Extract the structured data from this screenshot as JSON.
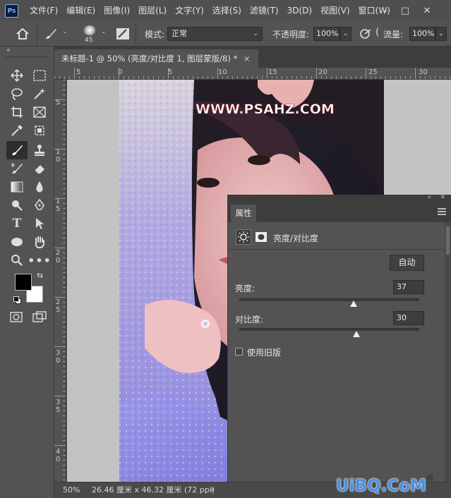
{
  "app": {
    "logo": "Ps"
  },
  "menu": [
    "文件(F)",
    "编辑(E)",
    "图像(I)",
    "图层(L)",
    "文字(Y)",
    "选择(S)",
    "滤镜(T)",
    "3D(D)",
    "视图(V)",
    "窗口(W)"
  ],
  "window_controls": {
    "minimize": "–",
    "maximize": "□",
    "close": "✕"
  },
  "options": {
    "brush_size": "45",
    "mode_label": "模式:",
    "mode_value": "正常",
    "opacity_label": "不透明度:",
    "opacity_value": "100%",
    "flow_label": "流量:",
    "flow_value": "100%"
  },
  "document": {
    "tab_title": "未标题-1 @ 50% (亮度/对比度 1, 图层蒙版/8) *",
    "tab_close": "×",
    "watermark_text": "WWW.PSAHZ.COM"
  },
  "rulers": {
    "h_labels": [
      "5",
      "0",
      "5",
      "10",
      "15",
      "20",
      "25",
      "30"
    ],
    "v_labels": [
      "5",
      "1 0",
      "1 5",
      "2 0",
      "2 5",
      "3 0",
      "3 5",
      "4 0"
    ]
  },
  "status": {
    "zoom": "50%",
    "dimensions": "26.46 厘米 x 46.32 厘米 (72 ppi)",
    "arrow": "›"
  },
  "properties": {
    "tab_label": "属性",
    "layer_type": "亮度/对比度",
    "auto_button": "自动",
    "brightness_label": "亮度:",
    "brightness_value": "37",
    "brightness_level": 0.637,
    "contrast_label": "对比度:",
    "contrast_value": "30",
    "contrast_level": 0.65,
    "legacy_label": "使用旧版"
  },
  "colors": {
    "foreground": "#000000",
    "background": "#ffffff",
    "accent": "#7fb7f5"
  },
  "overlay_watermark": "UiBQ.CoM",
  "icons": [
    "home-icon",
    "brush-icon",
    "brush-preset-icon",
    "toggle-brush-panel-icon",
    "airbrush-icon",
    "smoothing-icon",
    "move-tool-icon",
    "marquee-tool-icon",
    "lasso-tool-icon",
    "magic-wand-icon",
    "crop-tool-icon",
    "frame-tool-icon",
    "eyedropper-icon",
    "spot-heal-icon",
    "brush-tool-icon",
    "stamp-tool-icon",
    "history-brush-icon",
    "eraser-icon",
    "gradient-icon",
    "blur-icon",
    "dodge-icon",
    "pen-icon",
    "type-icon",
    "path-select-icon",
    "ellipse-icon",
    "hand-icon",
    "zoom-icon",
    "more-tools-icon",
    "swap-colors-icon",
    "default-colors-icon",
    "quick-mask-icon",
    "screen-mode-icon",
    "sun-adjust-icon",
    "mask-icon",
    "panel-menu-icon",
    "collapse-icon"
  ]
}
